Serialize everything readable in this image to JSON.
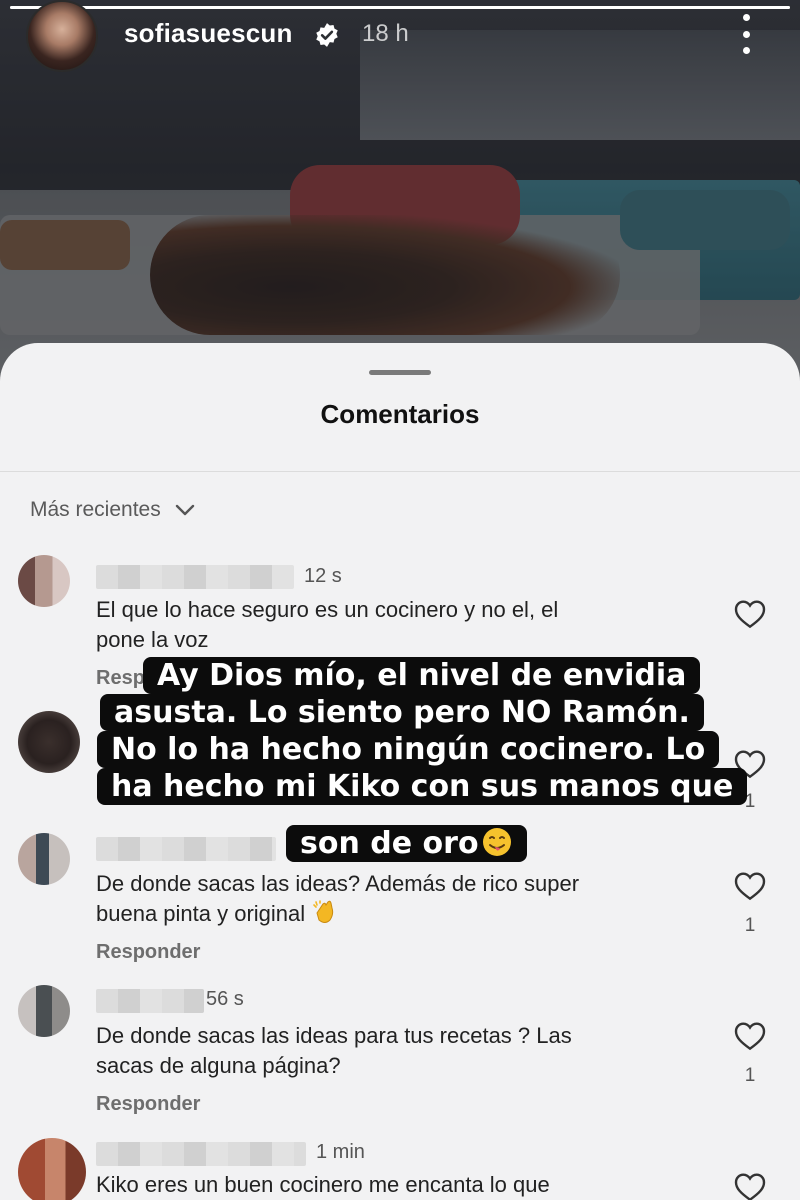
{
  "story": {
    "username": "sofiasuescun",
    "time": "18 h",
    "progress": 1.0
  },
  "comments_sheet": {
    "title": "Comentarios",
    "sort_label": "Más recientes"
  },
  "comments": [
    {
      "time": "12 s",
      "text": "El que lo hace seguro es un cocinero y no el, el pone la voz",
      "text_lines": [
        "El que lo hace seguro es un cocinero y no el, el",
        "pone la voz"
      ],
      "reply": "Resp",
      "likes": ""
    },
    {
      "time": "",
      "text": "",
      "reply": "",
      "likes": "1"
    },
    {
      "time": "",
      "text_lines": [
        "De donde sacas las ideas? Además de rico super",
        "buena pinta y original"
      ],
      "reply": "Responder",
      "likes": "1"
    },
    {
      "time": "56 s",
      "text_lines": [
        "De donde sacas las ideas para tus recetas ? Las",
        "sacas de alguna página?"
      ],
      "reply": "Responder",
      "likes": "1"
    },
    {
      "time": "1 min",
      "text_lines": [
        "Kiko eres un buen cocinero me encanta lo que"
      ],
      "reply": "",
      "likes": ""
    }
  ],
  "overlay_text": {
    "lines": [
      "Ay Dios mío, el nivel de envidia",
      "asusta. Lo siento pero NO Ramón.",
      "No lo ha hecho ningún cocinero. Lo",
      "ha hecho mi Kiko con sus manos que",
      "son de oro"
    ]
  },
  "icons": {
    "verified": "verified-badge-icon",
    "more": "more-options-icon",
    "sort": "chevron-down-icon",
    "like": "heart-icon"
  }
}
